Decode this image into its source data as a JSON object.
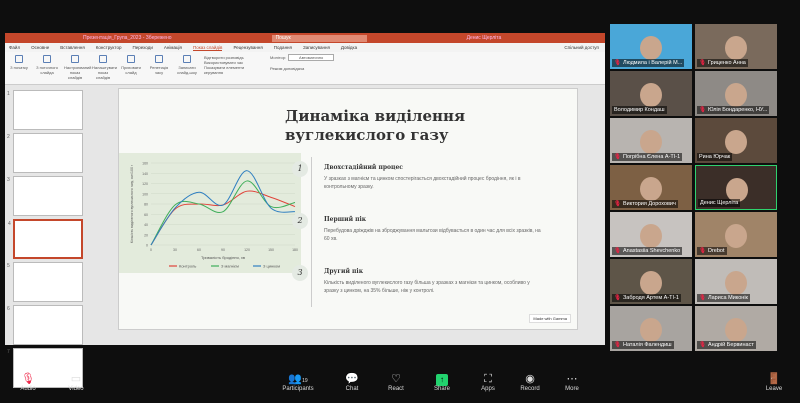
{
  "ppt": {
    "title": "Презентація_Група_2023 - Збережено",
    "search": "Пошук",
    "user": "Денис Щерліта",
    "tabs": [
      "Файл",
      "Основне",
      "Вставлення",
      "Конструктор",
      "Переходи",
      "Анімація",
      "Показ слайдів",
      "Рецензування",
      "Подання",
      "Записування",
      "Довідка"
    ],
    "active_tab": 6,
    "share": "Спільний доступ",
    "ribbon": [
      "З початку",
      "З поточного слайда",
      "Настроюваний показ слайдів",
      "Налаштувати показ слайдів",
      "Приховати слайд",
      "Репетиція часу",
      "Записати слайд-шоу"
    ],
    "checks": [
      "Відтворити розповідь",
      "Використовувати час",
      "Показувати елементи керування"
    ],
    "monitor_label": "Монітор:",
    "monitor_value": "Автоматично",
    "presenter": "Режим доповідача"
  },
  "slide": {
    "title": "Динаміка виділення вуглекислого газу",
    "steps": [
      {
        "n": "1",
        "title": "Двохстадійний процес",
        "text": "У зразках з магнієм та цинком спостерігається двохстадійний процес бродіння, як і в контрольному зразку."
      },
      {
        "n": "2",
        "title": "Перший пік",
        "text": "Перебудова дріжджів на зброджування мальтози відбувається в один час для всіх зразків, на 60 хв."
      },
      {
        "n": "3",
        "title": "Другий пік",
        "text": "Кількість виділеного вуглекислого газу більша у зразках з магнієм та цинком, особливо у зразку з цинком, на 35% більше, ніж у контролі."
      }
    ],
    "badge": "Made with Gamma"
  },
  "chart_data": {
    "type": "line",
    "xlabel": "Тривалість бродіння, хв",
    "ylabel": "Кількість виділеного вуглекислого газу, см³/100 г",
    "x": [
      0,
      30,
      60,
      90,
      120,
      150,
      180
    ],
    "xlim": [
      0,
      180
    ],
    "ylim": [
      0,
      160
    ],
    "yticks": [
      0,
      20,
      40,
      60,
      80,
      100,
      120,
      140,
      160
    ],
    "grid": true,
    "legend": "bottom",
    "series": [
      {
        "name": "Контроль",
        "color": "#e0433a",
        "values": [
          0,
          70,
          80,
          78,
          105,
          93,
          75
        ]
      },
      {
        "name": "З магнієм",
        "color": "#3fae5a",
        "values": [
          0,
          78,
          80,
          65,
          125,
          75,
          83
        ]
      },
      {
        "name": "З цинком",
        "color": "#2f7fc1",
        "values": [
          0,
          72,
          103,
          78,
          145,
          72,
          65
        ]
      }
    ]
  },
  "participants": [
    {
      "name": "Людмила і Валерій М...",
      "muted": true
    },
    {
      "name": "Гриценко Анна",
      "muted": true
    },
    {
      "name": "Володимир Кондаш",
      "muted": false
    },
    {
      "name": "Юлія Бондаренко, НУ...",
      "muted": true
    },
    {
      "name": "Погрібна Єлена А-ТІ-1",
      "muted": true
    },
    {
      "name": "Рина Юрчак",
      "muted": false
    },
    {
      "name": "Виктория Дорохович",
      "muted": true
    },
    {
      "name": "Денис Щерліта",
      "muted": false,
      "active": true
    },
    {
      "name": "Anastasiia Shevchenko",
      "muted": true
    },
    {
      "name": "Drebot",
      "muted": true
    },
    {
      "name": "Забродя Артем А-ТІ-1",
      "muted": true
    },
    {
      "name": "Лариса Миконік",
      "muted": true
    },
    {
      "name": "Наталія Фалендиш",
      "muted": true
    },
    {
      "name": "Андрій Бервинаст",
      "muted": true
    }
  ],
  "toolbar": {
    "audio": "Audio",
    "video": "Video",
    "participants": "Participants",
    "participants_count": "19",
    "chat": "Chat",
    "react": "React",
    "share": "Share",
    "apps": "Apps",
    "record": "Record",
    "more": "More",
    "leave": "Leave"
  }
}
